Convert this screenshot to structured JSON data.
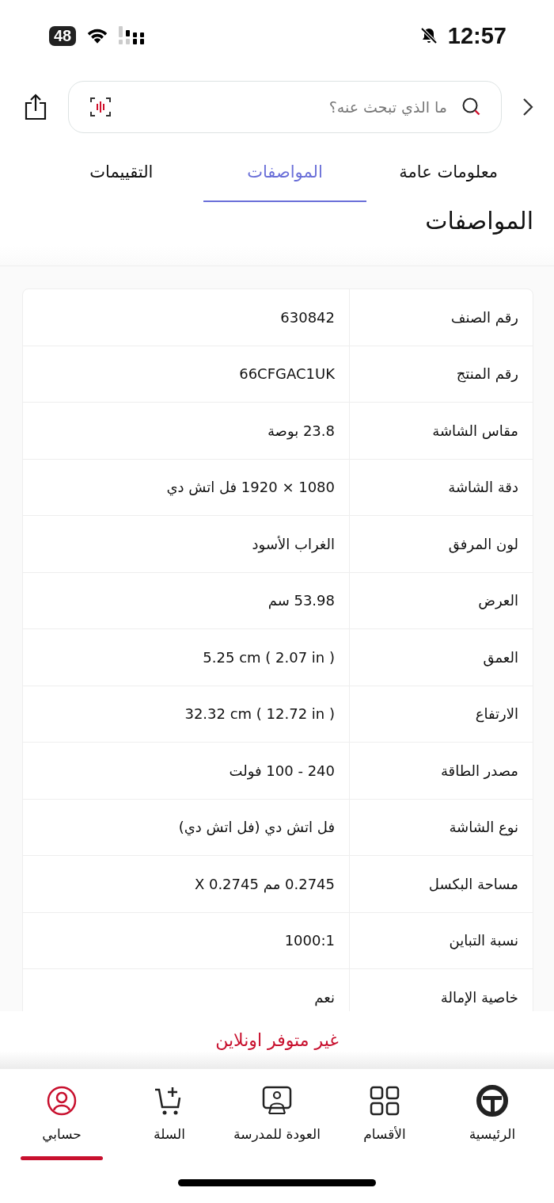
{
  "status_bar": {
    "battery": "48",
    "time": "12:57"
  },
  "search": {
    "placeholder": "ما الذي تبحث عنه؟"
  },
  "tabs": [
    {
      "label": "معلومات عامة",
      "selected": false
    },
    {
      "label": "المواصفات",
      "selected": true
    },
    {
      "label": "التقييمات",
      "selected": false
    }
  ],
  "section_title": "المواصفات",
  "specs": [
    {
      "label": "رقم الصنف",
      "value": "630842"
    },
    {
      "label": "رقم المنتج",
      "value": "66CFGAC1UK"
    },
    {
      "label": "مقاس الشاشة",
      "value": "23.8 بوصة"
    },
    {
      "label": "دقة الشاشة",
      "value": "1080 × 1920 فل اتش دي"
    },
    {
      "label": "لون المرفق",
      "value": "الغراب الأسود"
    },
    {
      "label": "العرض",
      "value": "53.98 سم"
    },
    {
      "label": "العمق",
      "value": "5.25 cm ( 2.07 in )"
    },
    {
      "label": "الارتفاع",
      "value": "32.32 cm ( 12.72 in )"
    },
    {
      "label": "مصدر الطاقة",
      "value": "240 - 100 فولت"
    },
    {
      "label": "نوع الشاشة",
      "value": "فل اتش دي (فل اتش دي)"
    },
    {
      "label": "مساحة البكسل",
      "value": "0.2745 مم X 0.2745"
    },
    {
      "label": "نسبة التباين",
      "value": "1000:1"
    },
    {
      "label": "خاصية الإمالة",
      "value": "نعم"
    }
  ],
  "availability": "غير متوفر اونلاين",
  "nav": [
    {
      "kind": "home",
      "label": "الرئيسية",
      "selected": false
    },
    {
      "kind": "categories",
      "label": "الأقسام",
      "selected": false
    },
    {
      "kind": "school",
      "label": "العودة للمدرسة",
      "selected": false
    },
    {
      "kind": "cart",
      "label": "السلة",
      "selected": false
    },
    {
      "kind": "account",
      "label": "حسابي",
      "selected": true
    }
  ]
}
